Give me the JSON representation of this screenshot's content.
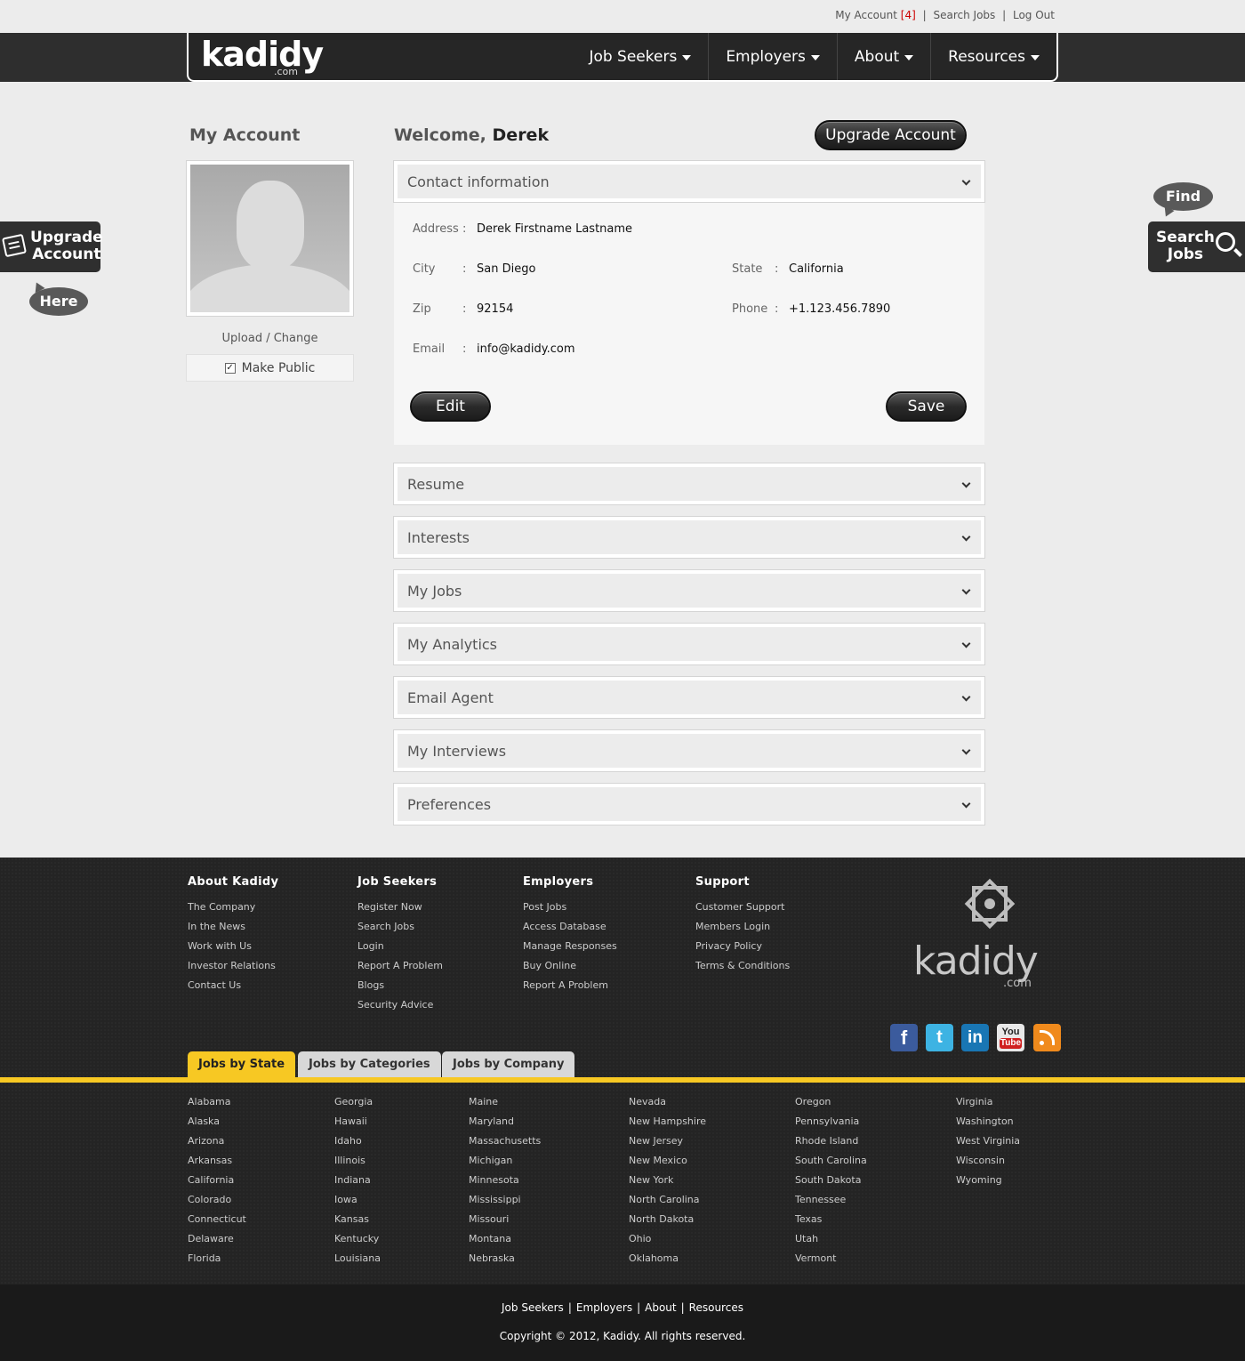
{
  "util": {
    "my_account": "My Account",
    "count": "[4]",
    "search_jobs": "Search Jobs",
    "log_out": "Log Out",
    "sep": "|"
  },
  "header": {
    "logo": "kadidy",
    "logo_suffix": ".com",
    "nav": [
      "Job Seekers",
      "Employers",
      "About",
      "Resources"
    ]
  },
  "side": {
    "upgrade_line1": "Upgrade",
    "upgrade_line2": "Account",
    "here": "Here",
    "find": "Find",
    "search_line1": "Search",
    "search_line2": "Jobs"
  },
  "left": {
    "title": "My Account",
    "upload": "Upload / Change",
    "make_public": "Make Public",
    "make_public_checked": true
  },
  "main": {
    "welcome_prefix": "Welcome,",
    "user_name": "Derek",
    "upgrade_button": "Upgrade Account",
    "contact_panel": "Contact information",
    "contact": {
      "address_label": "Address",
      "address": "Derek Firstname Lastname",
      "city_label": "City",
      "city": "San Diego",
      "state_label": "State",
      "state": "California",
      "zip_label": "Zip",
      "zip": "92154",
      "phone_label": "Phone",
      "phone": "+1.123.456.7890",
      "email_label": "Email",
      "email": "info@kadidy.com",
      "colon": ":"
    },
    "edit_button": "Edit",
    "save_button": "Save",
    "panels": [
      "Resume",
      "Interests",
      "My Jobs",
      "My Analytics",
      "Email Agent",
      "My Interviews",
      "Preferences"
    ]
  },
  "footer": {
    "columns": [
      {
        "title": "About Kadidy",
        "links": [
          "The Company",
          "In the News",
          "Work with Us",
          "Investor Relations",
          "Contact Us"
        ]
      },
      {
        "title": "Job Seekers",
        "links": [
          "Register Now",
          "Search Jobs",
          "Login",
          "Report A Problem",
          "Blogs",
          "Security Advice"
        ]
      },
      {
        "title": "Employers",
        "links": [
          "Post Jobs",
          "Access Database",
          "Manage Responses",
          "Buy Online",
          "Report A Problem"
        ]
      },
      {
        "title": "Support",
        "links": [
          "Customer Support",
          "Members Login",
          "Privacy Policy",
          "Terms & Conditions"
        ]
      }
    ],
    "logo": "kadidy",
    "logo_suffix": ".com",
    "social": [
      {
        "name": "facebook-icon",
        "glyph": "f"
      },
      {
        "name": "twitter-icon",
        "glyph": "t"
      },
      {
        "name": "linkedin-icon",
        "glyph": "in"
      },
      {
        "name": "youtube-icon",
        "glyph": "You",
        "glyph2": "Tube"
      },
      {
        "name": "rss-icon",
        "glyph": ""
      }
    ],
    "tabs": [
      "Jobs by State",
      "Jobs by Categories",
      "Jobs by Company"
    ],
    "states": [
      [
        "Alabama",
        "Alaska",
        "Arizona",
        "Arkansas",
        "California",
        "Colorado",
        "Connecticut",
        "Delaware",
        "Florida"
      ],
      [
        "Georgia",
        "Hawaii",
        "Idaho",
        "Illinois",
        "Indiana",
        "Iowa",
        "Kansas",
        "Kentucky",
        "Louisiana"
      ],
      [
        "Maine",
        "Maryland",
        "Massachusetts",
        "Michigan",
        "Minnesota",
        "Mississippi",
        "Missouri",
        "Montana",
        "Nebraska"
      ],
      [
        "Nevada",
        "New Hampshire",
        "New Jersey",
        "New Mexico",
        "New York",
        "North Carolina",
        "North Dakota",
        "Ohio",
        "Oklahoma"
      ],
      [
        "Oregon",
        "Pennsylvania",
        "Rhode Island",
        "South Carolina",
        "South Dakota",
        "Tennessee",
        "Texas",
        "Utah",
        "Vermont"
      ],
      [
        "Virginia",
        "Washington",
        "West Virginia",
        "Wisconsin",
        "Wyoming"
      ]
    ],
    "bottom_links": [
      "Job Seekers",
      "Employers",
      "About",
      "Resources"
    ],
    "copyright": "Copyright © 2012, Kadidy. All rights reserved."
  },
  "colors": {
    "accent_yellow": "#f7c823",
    "dark": "#2e2e2e",
    "count_red": "#cc0000"
  }
}
